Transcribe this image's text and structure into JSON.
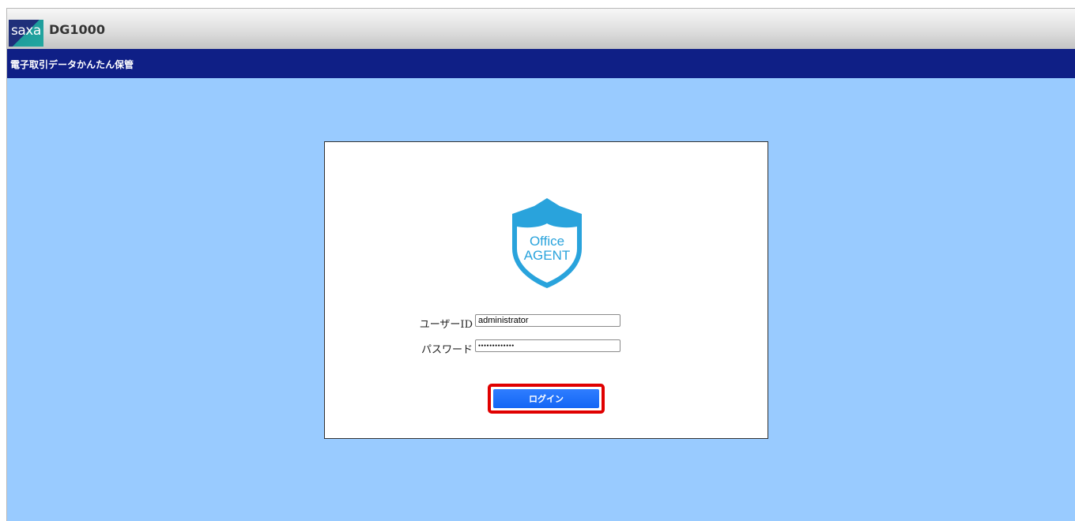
{
  "header": {
    "brand": "saxa",
    "product": "DG1000"
  },
  "titlebar": {
    "title": "電子取引データかんたん保管"
  },
  "login": {
    "logo_line1": "Office",
    "logo_line2": "AGENT",
    "user_id_label": "ユーザーID",
    "user_id_value": "administrator",
    "password_label": "パスワード",
    "password_value": "●●●●●●●●●●●●●",
    "login_button": "ログイン"
  },
  "colors": {
    "background": "#99cbff",
    "titlebar": "#0f1f86",
    "button": "#1366f5",
    "highlight": "#e00000",
    "shield": "#29a3dc"
  }
}
